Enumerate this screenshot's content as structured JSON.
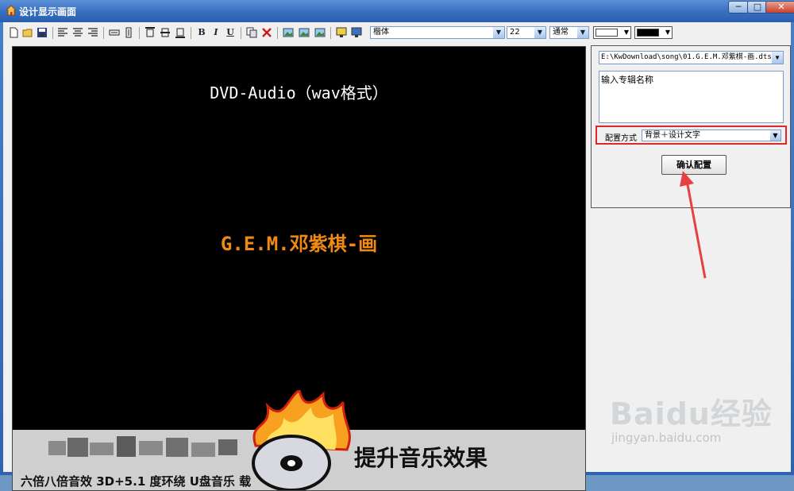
{
  "window": {
    "title": "设计显示画面",
    "controls": [
      "─",
      "□",
      "✕"
    ]
  },
  "toolbar": {
    "buttons": [
      "new-file",
      "open-folder",
      "save",
      "align-left",
      "align-center",
      "align-right",
      "stretch-horizontal",
      "stretch-vertical",
      "align-top",
      "align-middle",
      "align-bottom",
      "B",
      "I",
      "U",
      "copy",
      "delete",
      "image-1",
      "image-2",
      "image-3",
      "display-1",
      "display-2"
    ],
    "font_family": "楷体",
    "font_size": "22",
    "font_style": "通常",
    "fore_color": "#ffffff",
    "back_color": "#000000"
  },
  "canvas": {
    "album_title": "DVD-Audio（wav格式）",
    "artist_title": "G.E.M.邓紫棋-画",
    "banner_heading": "提升音乐效果",
    "banner_line": "六倍八倍音效 3D+5.1 度环绕 U盘音乐 载"
  },
  "side_panel": {
    "file_path": "E:\\KwDownload\\song\\01.G.E.M.邓紫棋-画.dts",
    "album_name_placeholder": "输入专辑名称",
    "config_label": "配置方式",
    "config_value": "背景＋设计文字",
    "confirm_label": "确认配置"
  },
  "watermark": {
    "logo": "Baidu经验",
    "url": "jingyan.baidu.com"
  },
  "colors": {
    "highlight": "#e02828",
    "artist_text": "#f08a14",
    "titlebar": "#3a70c0"
  }
}
